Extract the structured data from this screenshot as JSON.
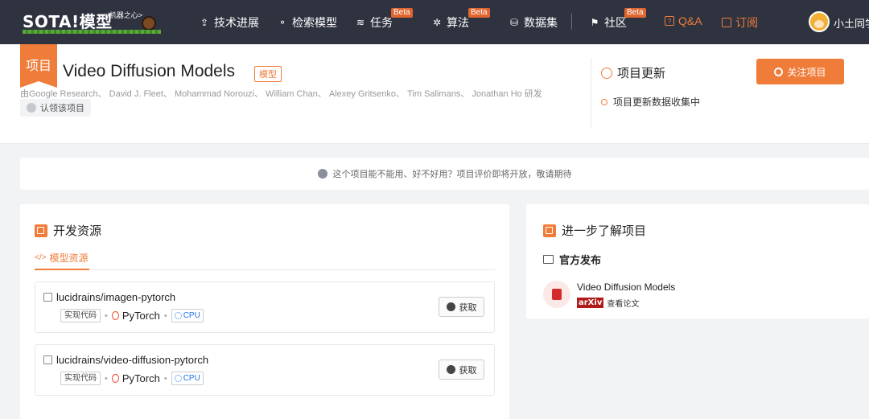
{
  "nav": {
    "logo_text": "SOTA!模型",
    "logo_sub": "</机器之心>",
    "items": [
      {
        "label": "技术进展",
        "icon": "tech-icon",
        "beta": ""
      },
      {
        "label": "检索模型",
        "icon": "model-search-icon",
        "beta": ""
      },
      {
        "label": "任务",
        "icon": "layers-icon",
        "beta": "Beta"
      },
      {
        "label": "算法",
        "icon": "algorithm-icon",
        "beta": "Beta"
      },
      {
        "label": "数据集",
        "icon": "database-icon",
        "beta": ""
      },
      {
        "label": "社区",
        "icon": "flag-icon",
        "beta": "Beta"
      },
      {
        "label": "Q&A",
        "icon": "qa-icon",
        "beta": ""
      },
      {
        "label": "订阅",
        "icon": "bookmark-icon",
        "beta": ""
      }
    ],
    "user_name": "小土同学"
  },
  "project": {
    "ribbon": "项目",
    "title": "Video Diffusion Models",
    "tag": "模型",
    "authors": "由Google Research、 David J. Fleet、 Mohammad Norouzi、 William Chan、 Alexey Gritsenko、 Tim Salimans、 Jonathan Ho 研发",
    "claim_label": "认领该项目"
  },
  "updates": {
    "title": "项目更新",
    "status": "项目更新数据收集中",
    "follow_label": "关注项目"
  },
  "notice": "这个项目能不能用、好不好用？项目评价即将开放，敬请期待",
  "dev_resources": {
    "title": "开发资源",
    "tab": "模型资源",
    "repos": [
      {
        "name": "lucidrains/imagen-pytorch",
        "chip": "实现代码",
        "framework": "PyTorch",
        "device": "CPU",
        "button": "获取"
      },
      {
        "name": "lucidrains/video-diffusion-pytorch",
        "chip": "实现代码",
        "framework": "PyTorch",
        "device": "CPU",
        "button": "获取"
      }
    ]
  },
  "learn_more": {
    "title": "进一步了解项目",
    "official_title": "官方发布",
    "paper_title": "Video Diffusion Models",
    "source_badge": "arXiv",
    "source_action": "查看论文"
  },
  "colors": {
    "accent": "#f07c3a",
    "nav_bg": "#2f3340",
    "page_bg": "#f2f3f5"
  }
}
